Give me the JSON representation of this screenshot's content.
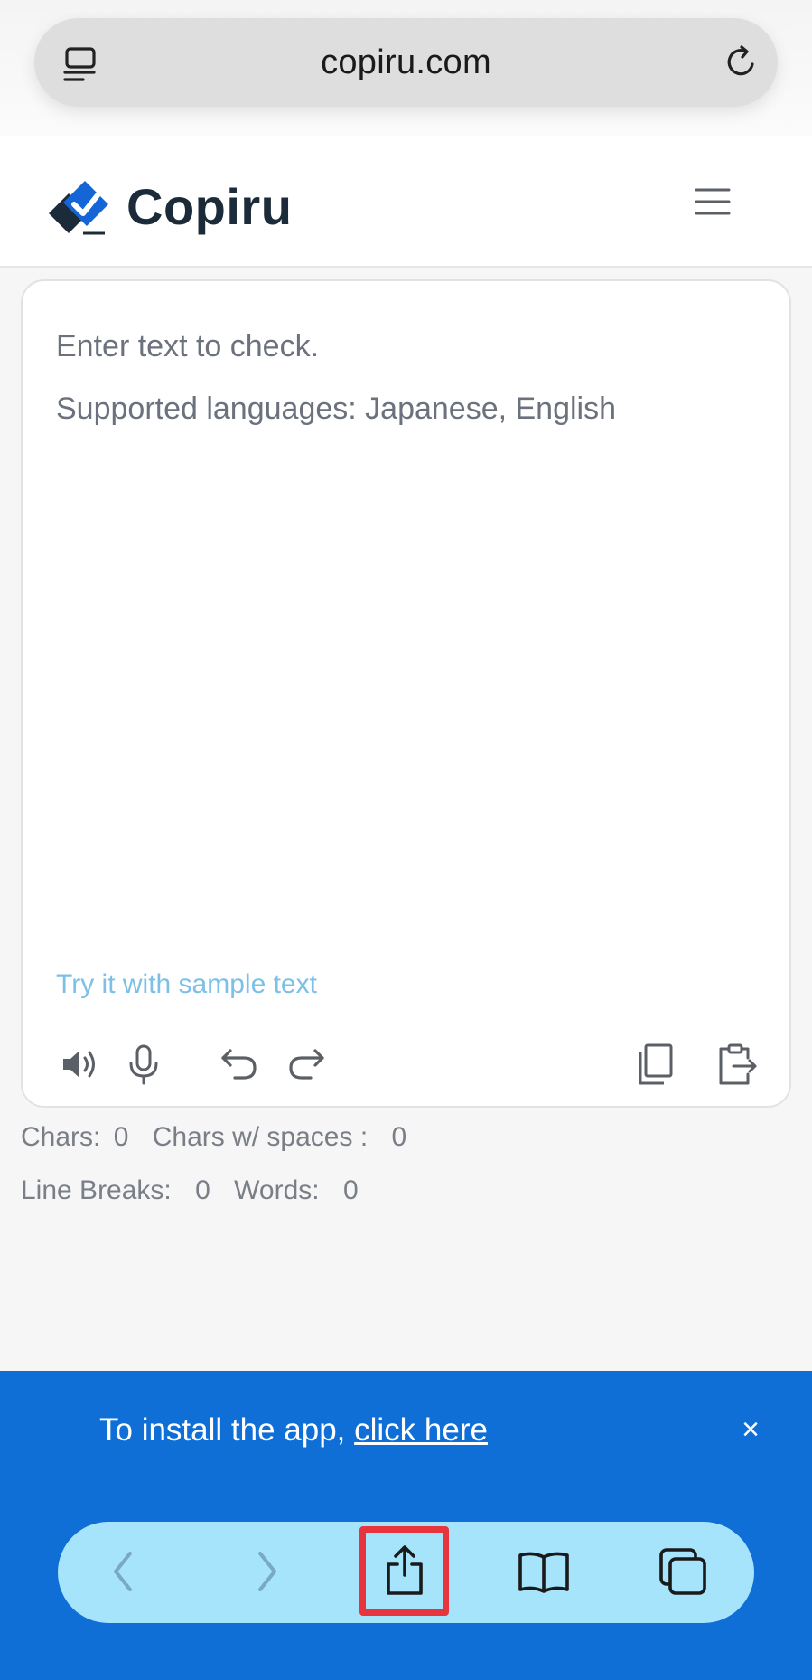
{
  "browser": {
    "url": "copiru.com"
  },
  "header": {
    "logo_text": "Copiru"
  },
  "editor": {
    "placeholder_line1": "Enter text to check.",
    "placeholder_line2": "Supported languages: Japanese, English",
    "sample_link": "Try it with sample text"
  },
  "stats": {
    "chars_label": "Chars:",
    "chars_value": "0",
    "chars_spaces_label": "Chars w/ spaces :",
    "chars_spaces_value": "0",
    "line_breaks_label": "Line Breaks:",
    "line_breaks_value": "0",
    "words_label": "Words:",
    "words_value": "0"
  },
  "banner": {
    "text": "To install the app, ",
    "link": "click here",
    "close": "×"
  },
  "colors": {
    "brand_dark": "#1c2b3a",
    "brand_blue": "#1466d6",
    "banner_bg": "#0f6fd7",
    "toolbar_bg": "#a6e4fb",
    "highlight": "#e8343c",
    "sample_link": "#7cc0e8"
  },
  "icons": [
    "reader-icon",
    "reload-icon",
    "logo-icon",
    "menu-icon",
    "speaker-icon",
    "microphone-icon",
    "undo-icon",
    "redo-icon",
    "copy-icon",
    "paste-icon",
    "back-icon",
    "forward-icon",
    "share-icon",
    "bookmarks-icon",
    "tabs-icon"
  ]
}
